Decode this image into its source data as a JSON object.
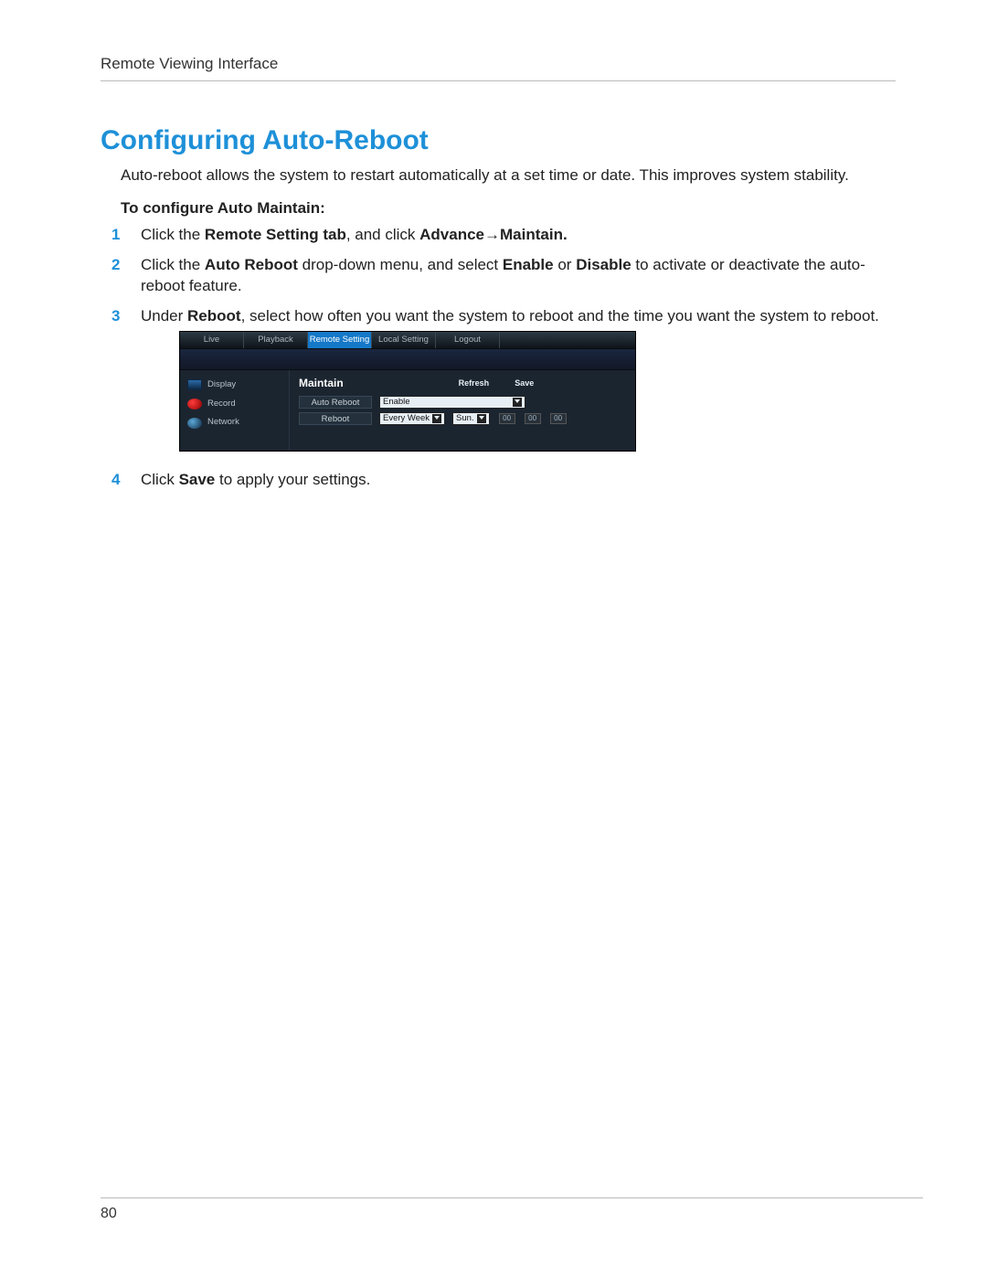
{
  "header": {
    "title": "Remote Viewing Interface"
  },
  "h1": "Configuring Auto-Reboot",
  "intro": "Auto-reboot allows the system to restart automatically at a set time or date. This improves system stability.",
  "subhead": "To configure Auto Maintain:",
  "steps": {
    "1": {
      "pre": "Click the ",
      "b1": "Remote Setting tab",
      "mid": ", and click ",
      "b2": "Advance→Maintain."
    },
    "2": {
      "pre": "Click the ",
      "b1": "Auto Reboot",
      "mid1": " drop-down menu, and select ",
      "b2": "Enable",
      "mid2": " or ",
      "b3": "Disable",
      "post": " to activate or deactivate the auto-reboot feature."
    },
    "3": {
      "pre": "Under ",
      "b1": "Reboot",
      "post": ", select how often you want the system to reboot and the time you want the system to reboot."
    },
    "4": {
      "pre": "Click ",
      "b1": "Save",
      "post": " to apply your settings."
    }
  },
  "fig": {
    "tabs": [
      "Live",
      "Playback",
      "Remote Setting",
      "Local Setting",
      "Logout"
    ],
    "activeTab": 2,
    "side": [
      "Display",
      "Record",
      "Network"
    ],
    "panelTitle": "Maintain",
    "btnRefresh": "Refresh",
    "btnSave": "Save",
    "row1Label": "Auto Reboot",
    "row1Value": "Enable",
    "row2Label": "Reboot",
    "row2Freq": "Every Week",
    "row2Day": "Sun.",
    "row2Time": [
      "00",
      "00",
      "00"
    ]
  },
  "pageNumber": "80"
}
